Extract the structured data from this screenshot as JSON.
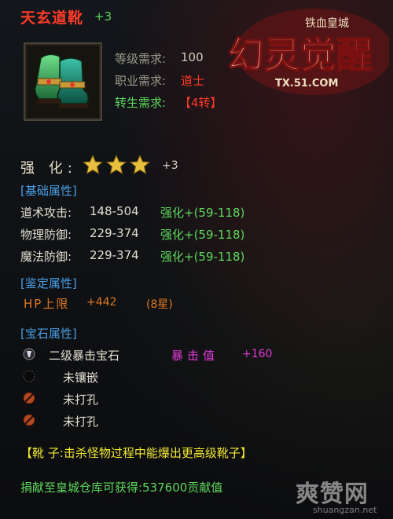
{
  "item": {
    "name": "天玄道靴",
    "plus": "+3"
  },
  "requirements": [
    {
      "label": "等级需求:",
      "value": "100",
      "color": "#d0cdbf"
    },
    {
      "label": "职业需求:",
      "value": "道士",
      "color": "#ff3a2a"
    },
    {
      "label": "转生需求:",
      "value": "【4转】",
      "color": "#ff3a2a"
    }
  ],
  "logo": {
    "top_text": "铁血皇城",
    "main_text": "幻灵觉醒",
    "url": "TX.51.COM"
  },
  "enhance": {
    "label": "强 化:",
    "stars": 3,
    "plus": "+3"
  },
  "basic_section": {
    "title": "[基础属性]",
    "rows": [
      {
        "name": "道术攻击:",
        "value": "148-504",
        "enhance": "强化+(59-118)"
      },
      {
        "name": "物理防御:",
        "value": "229-374",
        "enhance": "强化+(59-118)"
      },
      {
        "name": "魔法防御:",
        "value": "229-374",
        "enhance": "强化+(59-118)"
      }
    ]
  },
  "identify_section": {
    "title": "[鉴定属性]",
    "hp_label": "HP上限",
    "hp_value": "+442",
    "hp_star": "(8星)"
  },
  "gem_section": {
    "title": "[宝石属性]",
    "gems": [
      {
        "name": "二级暴击宝石",
        "icon": "crit-gem-icon"
      },
      {
        "name": "未镶嵌",
        "icon": "empty-socket-icon"
      },
      {
        "name": "未打孔",
        "icon": "unpunched-socket-icon"
      },
      {
        "name": "未打孔",
        "icon": "unpunched-socket-icon"
      }
    ],
    "stat_label": "暴击值",
    "stat_value": "+160"
  },
  "description": "【靴  子:击杀怪物过程中能爆出更高级靴子】",
  "donate": "捐献至皇城仓库可获得:537600贡献值",
  "watermark": {
    "cn": "爽赞网",
    "url": "shuangzan.net"
  },
  "colors": {
    "name_red": "#ff3b2a",
    "section_blue": "#4aa0e8",
    "green": "#5ed85e",
    "orange": "#e07a22",
    "magenta": "#e23ad8",
    "yellow": "#f2e830",
    "star_gold": "#e8c040"
  }
}
